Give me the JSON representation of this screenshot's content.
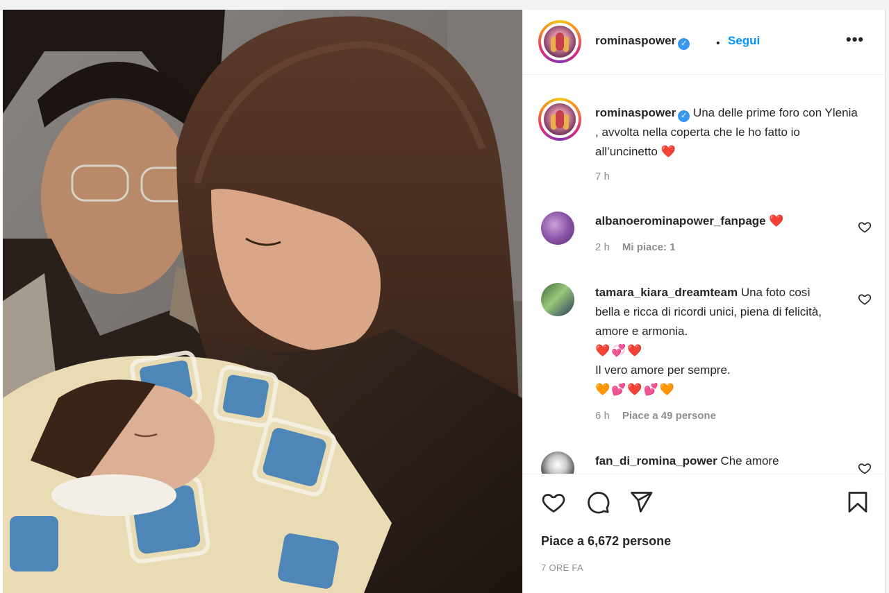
{
  "post": {
    "author": "rominaspower",
    "follow_label": "Segui",
    "separator": "•",
    "verified_glyph": "✓",
    "more_glyph": "•••",
    "caption": "Una delle prime foro con Ylenia , avvolta nella coperta che le ho fatto io all’uncinetto",
    "caption_emoji": "❤️",
    "caption_time": "7 h"
  },
  "comments": [
    {
      "username": "albanoerominapower_fanpage",
      "text": "",
      "emoji": "❤️",
      "time": "2 h",
      "likes": "Mi piace: 1"
    },
    {
      "username": "tamara_kiara_dreamteam",
      "text": "Una foto così bella e ricca di ricordi unici, piena di felicità, amore e armonia.",
      "emoji_line_1": "❤️💞❤️",
      "text_2": "Il vero amore per sempre.",
      "emoji_line_2": "🧡💕❤️💕🧡",
      "time": "6 h",
      "likes": "Piace a 49 persone"
    },
    {
      "username": "fan_di_romina_power",
      "text": "Che amore",
      "emoji": "❤️"
    }
  ],
  "footer": {
    "likes_total": "Piace a 6,672 persone",
    "timestamp": "7 ORE FA"
  },
  "icons": {
    "like": "heart-icon",
    "comment": "comment-icon",
    "share": "share-icon",
    "save": "bookmark-icon",
    "more": "more-options-icon"
  },
  "colors": {
    "accent": "#0095f6",
    "verified": "#3897f0",
    "muted": "#8e8e8e",
    "text": "#262626"
  }
}
